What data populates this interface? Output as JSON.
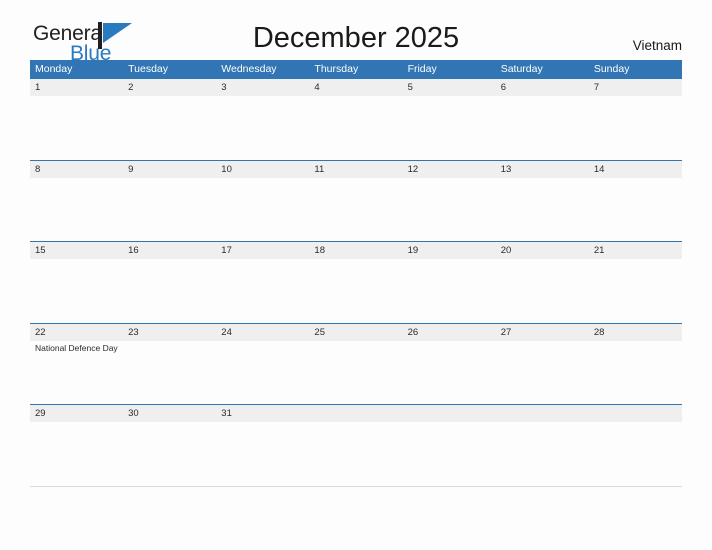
{
  "brand": {
    "name_part1": "General",
    "name_part2": "Blue",
    "flag_color": "#2a7ac0",
    "pole_color": "#231f20"
  },
  "header": {
    "title": "December 2025",
    "country": "Vietnam"
  },
  "theme": {
    "header_blue": "#3175b5",
    "band_gray": "#efefef",
    "page_background": "#fdfdfd",
    "text_color": "#2b2b2b"
  },
  "calendar": {
    "weekdays": [
      "Monday",
      "Tuesday",
      "Wednesday",
      "Thursday",
      "Friday",
      "Saturday",
      "Sunday"
    ],
    "weeks": [
      [
        {
          "day": "1",
          "event": ""
        },
        {
          "day": "2",
          "event": ""
        },
        {
          "day": "3",
          "event": ""
        },
        {
          "day": "4",
          "event": ""
        },
        {
          "day": "5",
          "event": ""
        },
        {
          "day": "6",
          "event": ""
        },
        {
          "day": "7",
          "event": ""
        }
      ],
      [
        {
          "day": "8",
          "event": ""
        },
        {
          "day": "9",
          "event": ""
        },
        {
          "day": "10",
          "event": ""
        },
        {
          "day": "11",
          "event": ""
        },
        {
          "day": "12",
          "event": ""
        },
        {
          "day": "13",
          "event": ""
        },
        {
          "day": "14",
          "event": ""
        }
      ],
      [
        {
          "day": "15",
          "event": ""
        },
        {
          "day": "16",
          "event": ""
        },
        {
          "day": "17",
          "event": ""
        },
        {
          "day": "18",
          "event": ""
        },
        {
          "day": "19",
          "event": ""
        },
        {
          "day": "20",
          "event": ""
        },
        {
          "day": "21",
          "event": ""
        }
      ],
      [
        {
          "day": "22",
          "event": "National Defence Day"
        },
        {
          "day": "23",
          "event": ""
        },
        {
          "day": "24",
          "event": ""
        },
        {
          "day": "25",
          "event": ""
        },
        {
          "day": "26",
          "event": ""
        },
        {
          "day": "27",
          "event": ""
        },
        {
          "day": "28",
          "event": ""
        }
      ],
      [
        {
          "day": "29",
          "event": ""
        },
        {
          "day": "30",
          "event": ""
        },
        {
          "day": "31",
          "event": ""
        },
        {
          "day": "",
          "event": ""
        },
        {
          "day": "",
          "event": ""
        },
        {
          "day": "",
          "event": ""
        },
        {
          "day": "",
          "event": ""
        }
      ]
    ]
  }
}
